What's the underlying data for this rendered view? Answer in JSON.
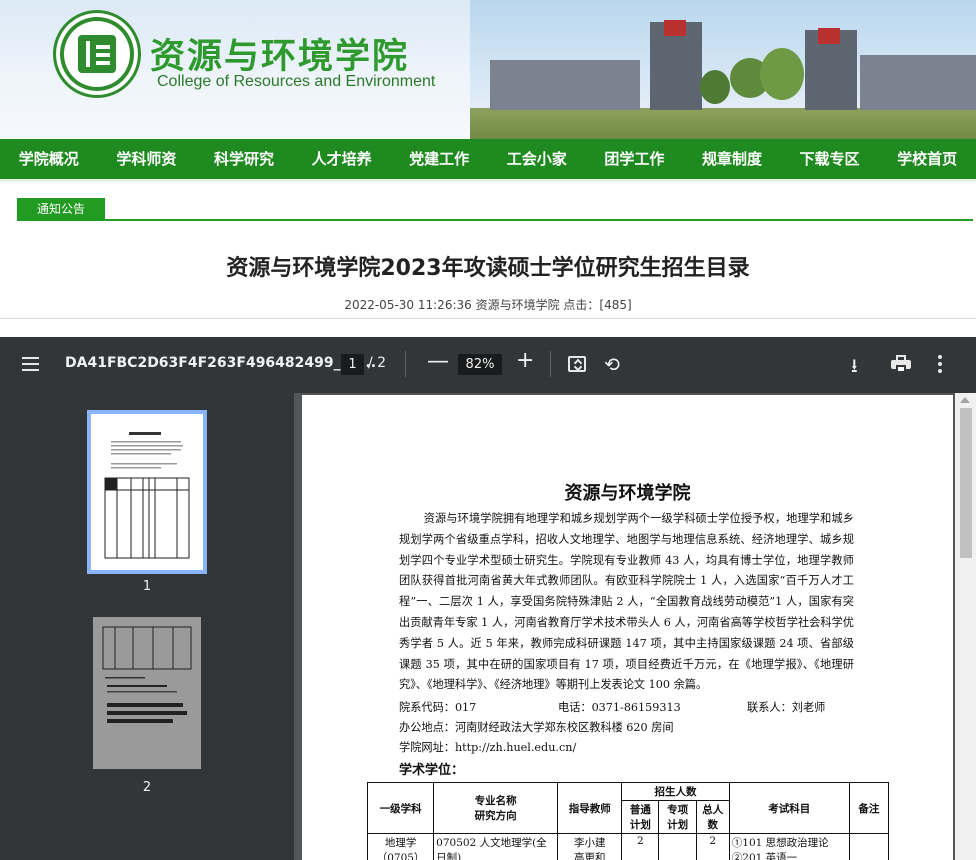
{
  "header": {
    "site_title": "资源与环境学院",
    "site_subtitle": "College of Resources and Environment"
  },
  "nav": [
    "学院概况",
    "学科师资",
    "科学研究",
    "人才培养",
    "党建工作",
    "工会小家",
    "团学工作",
    "规章制度",
    "下载专区",
    "学校首页"
  ],
  "notice": {
    "tab_label": "通知公告",
    "title": "资源与环境学院2023年攻读硕士学位研究生招生目录",
    "meta": "2022-05-30 11:26:36 资源与环境学院 点击：[485]"
  },
  "viewer": {
    "file_name": "DA41FBC2D63F4F263F496482499_83...",
    "current_page": "1",
    "total_pages": "/ 2",
    "zoom": "82%",
    "zoom_minus": "—",
    "zoom_plus": "+",
    "thumbnails": [
      {
        "label": "1"
      },
      {
        "label": "2"
      }
    ],
    "icons": [
      "menu-icon",
      "fit-page-icon",
      "rotate-icon",
      "download-icon",
      "print-icon",
      "more-icon"
    ]
  },
  "document": {
    "heading": "资源与环境学院",
    "intro": "资源与环境学院拥有地理学和城乡规划学两个一级学科硕士学位授予权，地理学和城乡规划学两个省级重点学科，招收人文地理学、地图学与地理信息系统、经济地理学、城乡规划学四个专业学术型硕士研究生。学院现有专业教师 43 人，均具有博士学位，地理学教师团队获得首批河南省黄大年式教师团队。有欧亚科学院院士 1 人，入选国家“百千万人才工程”一、二层次 1 人，享受国务院特殊津贴 2 人，“全国教育战线劳动模范”1 人，国家有突出贡献青年专家 1 人，河南省教育厅学术技术带头人 6 人，河南省高等学校哲学社会科学优秀学者 5 人。近 5 年来，教师完成科研课题 147 项，其中主持国家级课题 24 项、省部级课题 35 项，其中在研的国家项目有 17 项，项目经费近千万元，在《地理学报》、《地理研究》、《地理科学》、《经济地理》等期刊上发表论文 100 余篇。",
    "dept_code": "院系代码：017",
    "phone": "电话：0371-86159313",
    "contact_person": "联系人：刘老师",
    "office": "办公地点：河南财经政法大学郑东校区教科楼 620 房间",
    "website": "学院网址：http://zh.huel.edu.cn/",
    "section": "学术学位：",
    "table": {
      "h_discipline": "一级学科",
      "h_major_1": "专业名称",
      "h_major_2": "研究方向",
      "h_advisor": "指导教师",
      "h_quota": "招生人数",
      "h_regular_1": "普通",
      "h_regular_2": "计划",
      "h_special_1": "专项",
      "h_special_2": "计划",
      "h_total_1": "总人",
      "h_total_2": "数",
      "h_exam": "考试科目",
      "h_note": "备注",
      "row1": {
        "discipline_1": "地理学",
        "discipline_2": "（0705）",
        "major_1": "070502 人文地理学(全",
        "major_2": "日制)",
        "advisor_1": "李小建",
        "advisor_2": "高更和",
        "regular": "2",
        "special": "",
        "total": "2",
        "exam_1": "①101 思想政治理论",
        "exam_2": "②201 英语一",
        "note": ""
      }
    }
  }
}
